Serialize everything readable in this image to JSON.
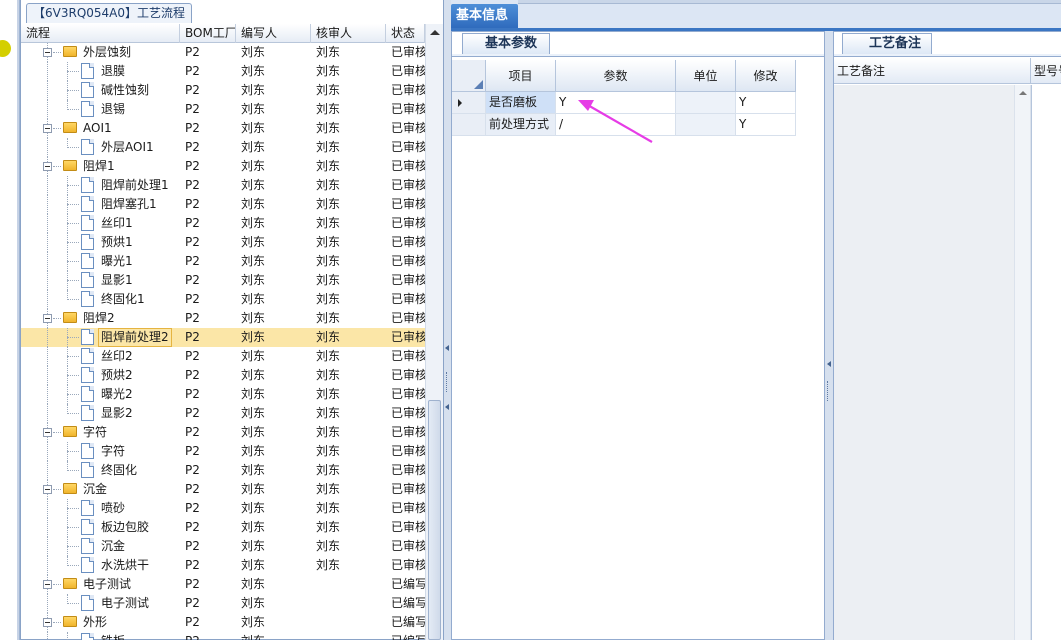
{
  "tree_panel": {
    "title": "【6V3RQ054A0】工艺流程",
    "columns": [
      "流程",
      "BOM工厂",
      "编写人",
      "核审人",
      "状态"
    ],
    "rows": [
      {
        "level": 1,
        "kind": "folder",
        "name": "外层蚀刻",
        "bom": "P2",
        "editor": "刘东",
        "reviewer": "刘东",
        "status": "已审核"
      },
      {
        "level": 2,
        "kind": "doc",
        "name": "退膜",
        "bom": "P2",
        "editor": "刘东",
        "reviewer": "刘东",
        "status": "已审核"
      },
      {
        "level": 2,
        "kind": "doc",
        "name": "碱性蚀刻",
        "bom": "P2",
        "editor": "刘东",
        "reviewer": "刘东",
        "status": "已审核"
      },
      {
        "level": 2,
        "kind": "doc",
        "name": "退锡",
        "bom": "P2",
        "editor": "刘东",
        "reviewer": "刘东",
        "status": "已审核"
      },
      {
        "level": 1,
        "kind": "folder",
        "name": "AOI1",
        "bom": "P2",
        "editor": "刘东",
        "reviewer": "刘东",
        "status": "已审核"
      },
      {
        "level": 2,
        "kind": "doc",
        "name": "外层AOI1",
        "bom": "P2",
        "editor": "刘东",
        "reviewer": "刘东",
        "status": "已审核"
      },
      {
        "level": 1,
        "kind": "folder",
        "name": "阻焊1",
        "bom": "P2",
        "editor": "刘东",
        "reviewer": "刘东",
        "status": "已审核"
      },
      {
        "level": 2,
        "kind": "doc",
        "name": "阻焊前处理1",
        "bom": "P2",
        "editor": "刘东",
        "reviewer": "刘东",
        "status": "已审核"
      },
      {
        "level": 2,
        "kind": "doc",
        "name": "阻焊塞孔1",
        "bom": "P2",
        "editor": "刘东",
        "reviewer": "刘东",
        "status": "已审核"
      },
      {
        "level": 2,
        "kind": "doc",
        "name": "丝印1",
        "bom": "P2",
        "editor": "刘东",
        "reviewer": "刘东",
        "status": "已审核"
      },
      {
        "level": 2,
        "kind": "doc",
        "name": "预烘1",
        "bom": "P2",
        "editor": "刘东",
        "reviewer": "刘东",
        "status": "已审核"
      },
      {
        "level": 2,
        "kind": "doc",
        "name": "曝光1",
        "bom": "P2",
        "editor": "刘东",
        "reviewer": "刘东",
        "status": "已审核"
      },
      {
        "level": 2,
        "kind": "doc",
        "name": "显影1",
        "bom": "P2",
        "editor": "刘东",
        "reviewer": "刘东",
        "status": "已审核"
      },
      {
        "level": 2,
        "kind": "doc",
        "name": "终固化1",
        "bom": "P2",
        "editor": "刘东",
        "reviewer": "刘东",
        "status": "已审核"
      },
      {
        "level": 1,
        "kind": "folder",
        "name": "阻焊2",
        "bom": "P2",
        "editor": "刘东",
        "reviewer": "刘东",
        "status": "已审核"
      },
      {
        "level": 2,
        "kind": "doc",
        "name": "阻焊前处理2",
        "bom": "P2",
        "editor": "刘东",
        "reviewer": "刘东",
        "status": "已审核",
        "selected": true
      },
      {
        "level": 2,
        "kind": "doc",
        "name": "丝印2",
        "bom": "P2",
        "editor": "刘东",
        "reviewer": "刘东",
        "status": "已审核"
      },
      {
        "level": 2,
        "kind": "doc",
        "name": "预烘2",
        "bom": "P2",
        "editor": "刘东",
        "reviewer": "刘东",
        "status": "已审核"
      },
      {
        "level": 2,
        "kind": "doc",
        "name": "曝光2",
        "bom": "P2",
        "editor": "刘东",
        "reviewer": "刘东",
        "status": "已审核"
      },
      {
        "level": 2,
        "kind": "doc",
        "name": "显影2",
        "bom": "P2",
        "editor": "刘东",
        "reviewer": "刘东",
        "status": "已审核"
      },
      {
        "level": 1,
        "kind": "folder",
        "name": "字符",
        "bom": "P2",
        "editor": "刘东",
        "reviewer": "刘东",
        "status": "已审核"
      },
      {
        "level": 2,
        "kind": "doc",
        "name": "字符",
        "bom": "P2",
        "editor": "刘东",
        "reviewer": "刘东",
        "status": "已审核"
      },
      {
        "level": 2,
        "kind": "doc",
        "name": "终固化",
        "bom": "P2",
        "editor": "刘东",
        "reviewer": "刘东",
        "status": "已审核"
      },
      {
        "level": 1,
        "kind": "folder",
        "name": "沉金",
        "bom": "P2",
        "editor": "刘东",
        "reviewer": "刘东",
        "status": "已审核"
      },
      {
        "level": 2,
        "kind": "doc",
        "name": "喷砂",
        "bom": "P2",
        "editor": "刘东",
        "reviewer": "刘东",
        "status": "已审核"
      },
      {
        "level": 2,
        "kind": "doc",
        "name": "板边包胶",
        "bom": "P2",
        "editor": "刘东",
        "reviewer": "刘东",
        "status": "已审核"
      },
      {
        "level": 2,
        "kind": "doc",
        "name": "沉金",
        "bom": "P2",
        "editor": "刘东",
        "reviewer": "刘东",
        "status": "已审核"
      },
      {
        "level": 2,
        "kind": "doc",
        "name": "水洗烘干",
        "bom": "P2",
        "editor": "刘东",
        "reviewer": "刘东",
        "status": "已审核"
      },
      {
        "level": 1,
        "kind": "folder",
        "name": "电子测试",
        "bom": "P2",
        "editor": "刘东",
        "reviewer": "",
        "status": "已编写"
      },
      {
        "level": 2,
        "kind": "doc",
        "name": "电子测试",
        "bom": "P2",
        "editor": "刘东",
        "reviewer": "",
        "status": "已编写"
      },
      {
        "level": 1,
        "kind": "folder",
        "name": "外形",
        "bom": "P2",
        "editor": "刘东",
        "reviewer": "",
        "status": "已编写"
      },
      {
        "level": 2,
        "kind": "doc",
        "name": "铣板",
        "bom": "P2",
        "editor": "刘东",
        "reviewer": "",
        "status": "已编写"
      }
    ]
  },
  "info": {
    "tab_label": "基本信息",
    "params": {
      "tab_label": "基本参数",
      "columns": [
        "项目",
        "参数",
        "单位",
        "修改"
      ],
      "rows": [
        {
          "item": "是否磨板",
          "param": "Y",
          "unit": "",
          "mod": "Y",
          "current": true
        },
        {
          "item": "前处理方式",
          "param": "/",
          "unit": "",
          "mod": "Y"
        }
      ]
    },
    "notes": {
      "tab_label": "工艺备注",
      "columns": [
        "工艺备注",
        "型号号"
      ]
    }
  },
  "colors": {
    "selection": "#fbe6a7",
    "tab_blue": "#2f6bbd",
    "annotation_arrow": "#e63ce6"
  }
}
